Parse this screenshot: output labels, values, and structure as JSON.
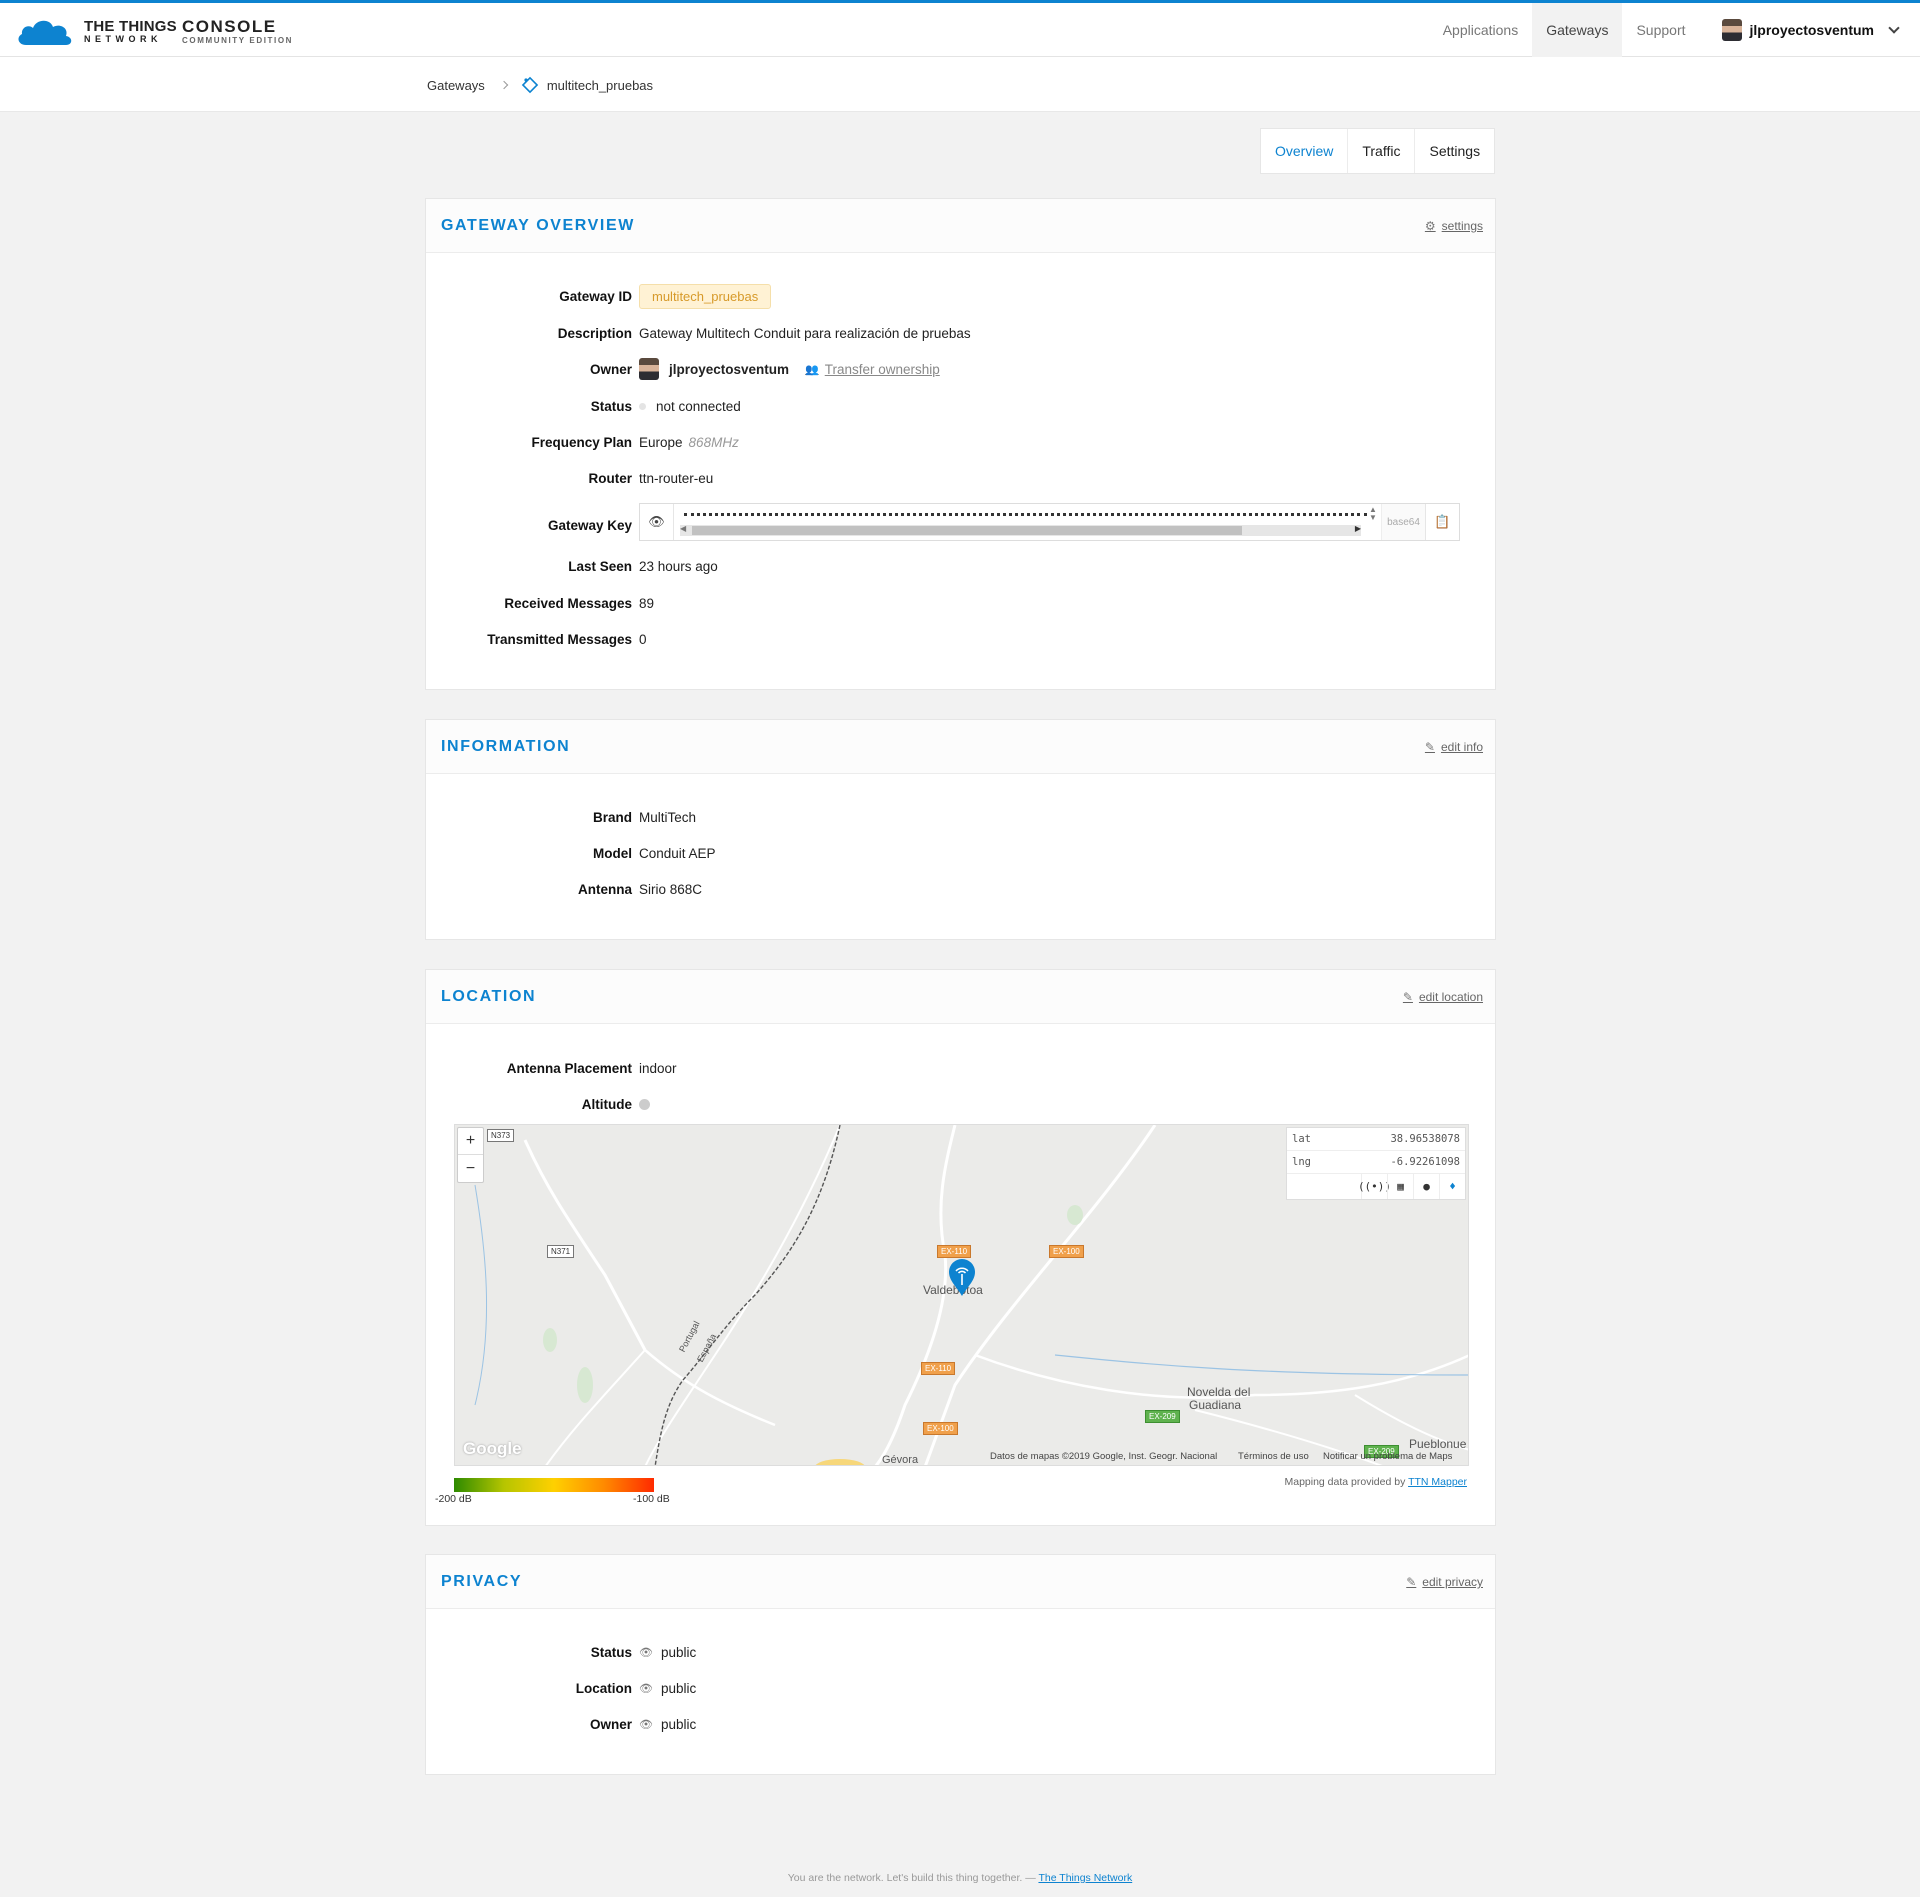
{
  "header": {
    "logo_top": "THE THINGS",
    "logo_bottom": "NETWORK",
    "console": "CONSOLE",
    "edition": "COMMUNITY EDITION",
    "nav": [
      {
        "label": "Applications"
      },
      {
        "label": "Gateways"
      },
      {
        "label": "Support"
      }
    ],
    "username": "jlproyectosventum"
  },
  "breadcrumb": {
    "root": "Gateways",
    "current": "multitech_pruebas"
  },
  "tabs": [
    {
      "label": "Overview"
    },
    {
      "label": "Traffic"
    },
    {
      "label": "Settings"
    }
  ],
  "overview": {
    "title": "GATEWAY OVERVIEW",
    "action": "settings",
    "fields": {
      "gateway_id_label": "Gateway ID",
      "gateway_id": "multitech_pruebas",
      "description_label": "Description",
      "description": "Gateway Multitech Conduit para realización de pruebas",
      "owner_label": "Owner",
      "owner": "jlproyectosventum",
      "transfer": "Transfer ownership",
      "status_label": "Status",
      "status": "not connected",
      "frequency_label": "Frequency Plan",
      "frequency": "Europe",
      "frequency_detail": "868MHz",
      "router_label": "Router",
      "router": "ttn-router-eu",
      "key_label": "Gateway Key",
      "key_encoding": "base64",
      "last_seen_label": "Last Seen",
      "last_seen": "23 hours ago",
      "received_label": "Received Messages",
      "received": "89",
      "transmitted_label": "Transmitted Messages",
      "transmitted": "0"
    }
  },
  "information": {
    "title": "INFORMATION",
    "action": "edit info",
    "brand_label": "Brand",
    "brand": "MultiTech",
    "model_label": "Model",
    "model": "Conduit AEP",
    "antenna_label": "Antenna",
    "antenna": "Sirio 868C"
  },
  "location": {
    "title": "LOCATION",
    "action": "edit location",
    "placement_label": "Antenna Placement",
    "placement": "indoor",
    "altitude_label": "Altitude",
    "map": {
      "zoom_in": "+",
      "zoom_out": "−",
      "lat_label": "lat",
      "lat": "38.96538078",
      "lng_label": "lng",
      "lng": "-6.92261098",
      "places": {
        "valdebotoa": "Valdebotoa",
        "novelda": "Novelda del",
        "novelda2": "Guadiana",
        "pueblonuevo": "Pueblonue",
        "gevora": "Gévora",
        "portugal": "Portugal",
        "espana": "España"
      },
      "roads": {
        "n373": "N373",
        "n371": "N371",
        "ex110a": "EX-110",
        "ex100a": "EX-100",
        "ex110b": "EX-110",
        "ex100b": "EX-100",
        "ex209a": "EX-209",
        "ex209b": "EX-209"
      },
      "google": "Google",
      "attribution": "Datos de mapas ©2019 Google, Inst. Geogr. Nacional",
      "terms": "Términos de uso",
      "report": "Notificar un problema de Maps"
    },
    "legend_min": "-200 dB",
    "legend_max": "-100 dB",
    "mapping_text": "Mapping data provided by",
    "mapping_link": "TTN Mapper",
    "colors": {
      "legend_low": "#2d8a00",
      "legend_high": "#ff2a00",
      "marker": "#0d83d0"
    }
  },
  "privacy": {
    "title": "PRIVACY",
    "action": "edit privacy",
    "status_label": "Status",
    "status": "public",
    "location_label": "Location",
    "location": "public",
    "owner_label": "Owner",
    "owner": "public"
  },
  "footer": {
    "text": "You are the network. Let's build this thing together. —",
    "link": "The Things Network"
  },
  "theme": {
    "accent": "#0d83d0",
    "pill_bg": "#fff2d4",
    "pill_text": "#d79a2a"
  }
}
